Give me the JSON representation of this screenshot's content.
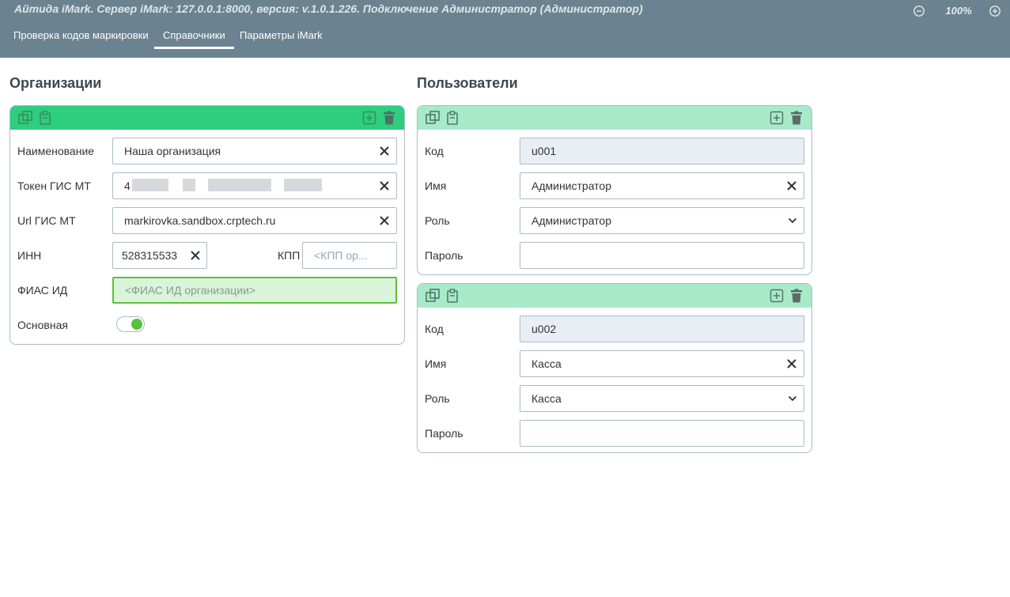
{
  "header": {
    "title": "Айтида iMark. Сервер iMark: 127.0.0.1:8000, версия: v.1.0.1.226. Подключение Администратор (Администратор)",
    "zoom": "100%",
    "tabs": [
      {
        "label": "Проверка кодов маркировки",
        "active": false
      },
      {
        "label": "Справочники",
        "active": true
      },
      {
        "label": "Параметры iMark",
        "active": false
      }
    ]
  },
  "organizations": {
    "title": "Организации",
    "card": {
      "name_label": "Наименование",
      "name_value": "Наша организация",
      "token_label": "Токен ГИС МТ",
      "token_value": "4",
      "url_label": "Url ГИС МТ",
      "url_value": "markirovka.sandbox.crptech.ru",
      "inn_label": "ИНН",
      "inn_value": "528315533",
      "kpp_label": "КПП",
      "kpp_placeholder": "<КПП ор...",
      "fias_label": "ФИАС ИД",
      "fias_placeholder": "<ФИАС ИД организации>",
      "main_label": "Основная",
      "main_on": true
    }
  },
  "users": {
    "title": "Пользователи",
    "cards": [
      {
        "code_label": "Код",
        "code_value": "u001",
        "name_label": "Имя",
        "name_value": "Администратор",
        "role_label": "Роль",
        "role_value": "Администратор",
        "password_label": "Пароль",
        "password_value": ""
      },
      {
        "code_label": "Код",
        "code_value": "u002",
        "name_label": "Имя",
        "name_value": "Касса",
        "role_label": "Роль",
        "role_value": "Касса",
        "password_label": "Пароль",
        "password_value": ""
      }
    ]
  },
  "colors": {
    "header_bg": "#6b8290",
    "org_toolbar": "#2dce7e",
    "user_toolbar": "#a8e9c9",
    "toggle_on": "#58c23b",
    "fias_bg": "#d9f4d8"
  },
  "icons": [
    "zoom-out-icon",
    "zoom-in-icon",
    "copy-icon",
    "paste-icon",
    "add-icon",
    "delete-icon",
    "clear-icon",
    "chevron-down-icon"
  ]
}
